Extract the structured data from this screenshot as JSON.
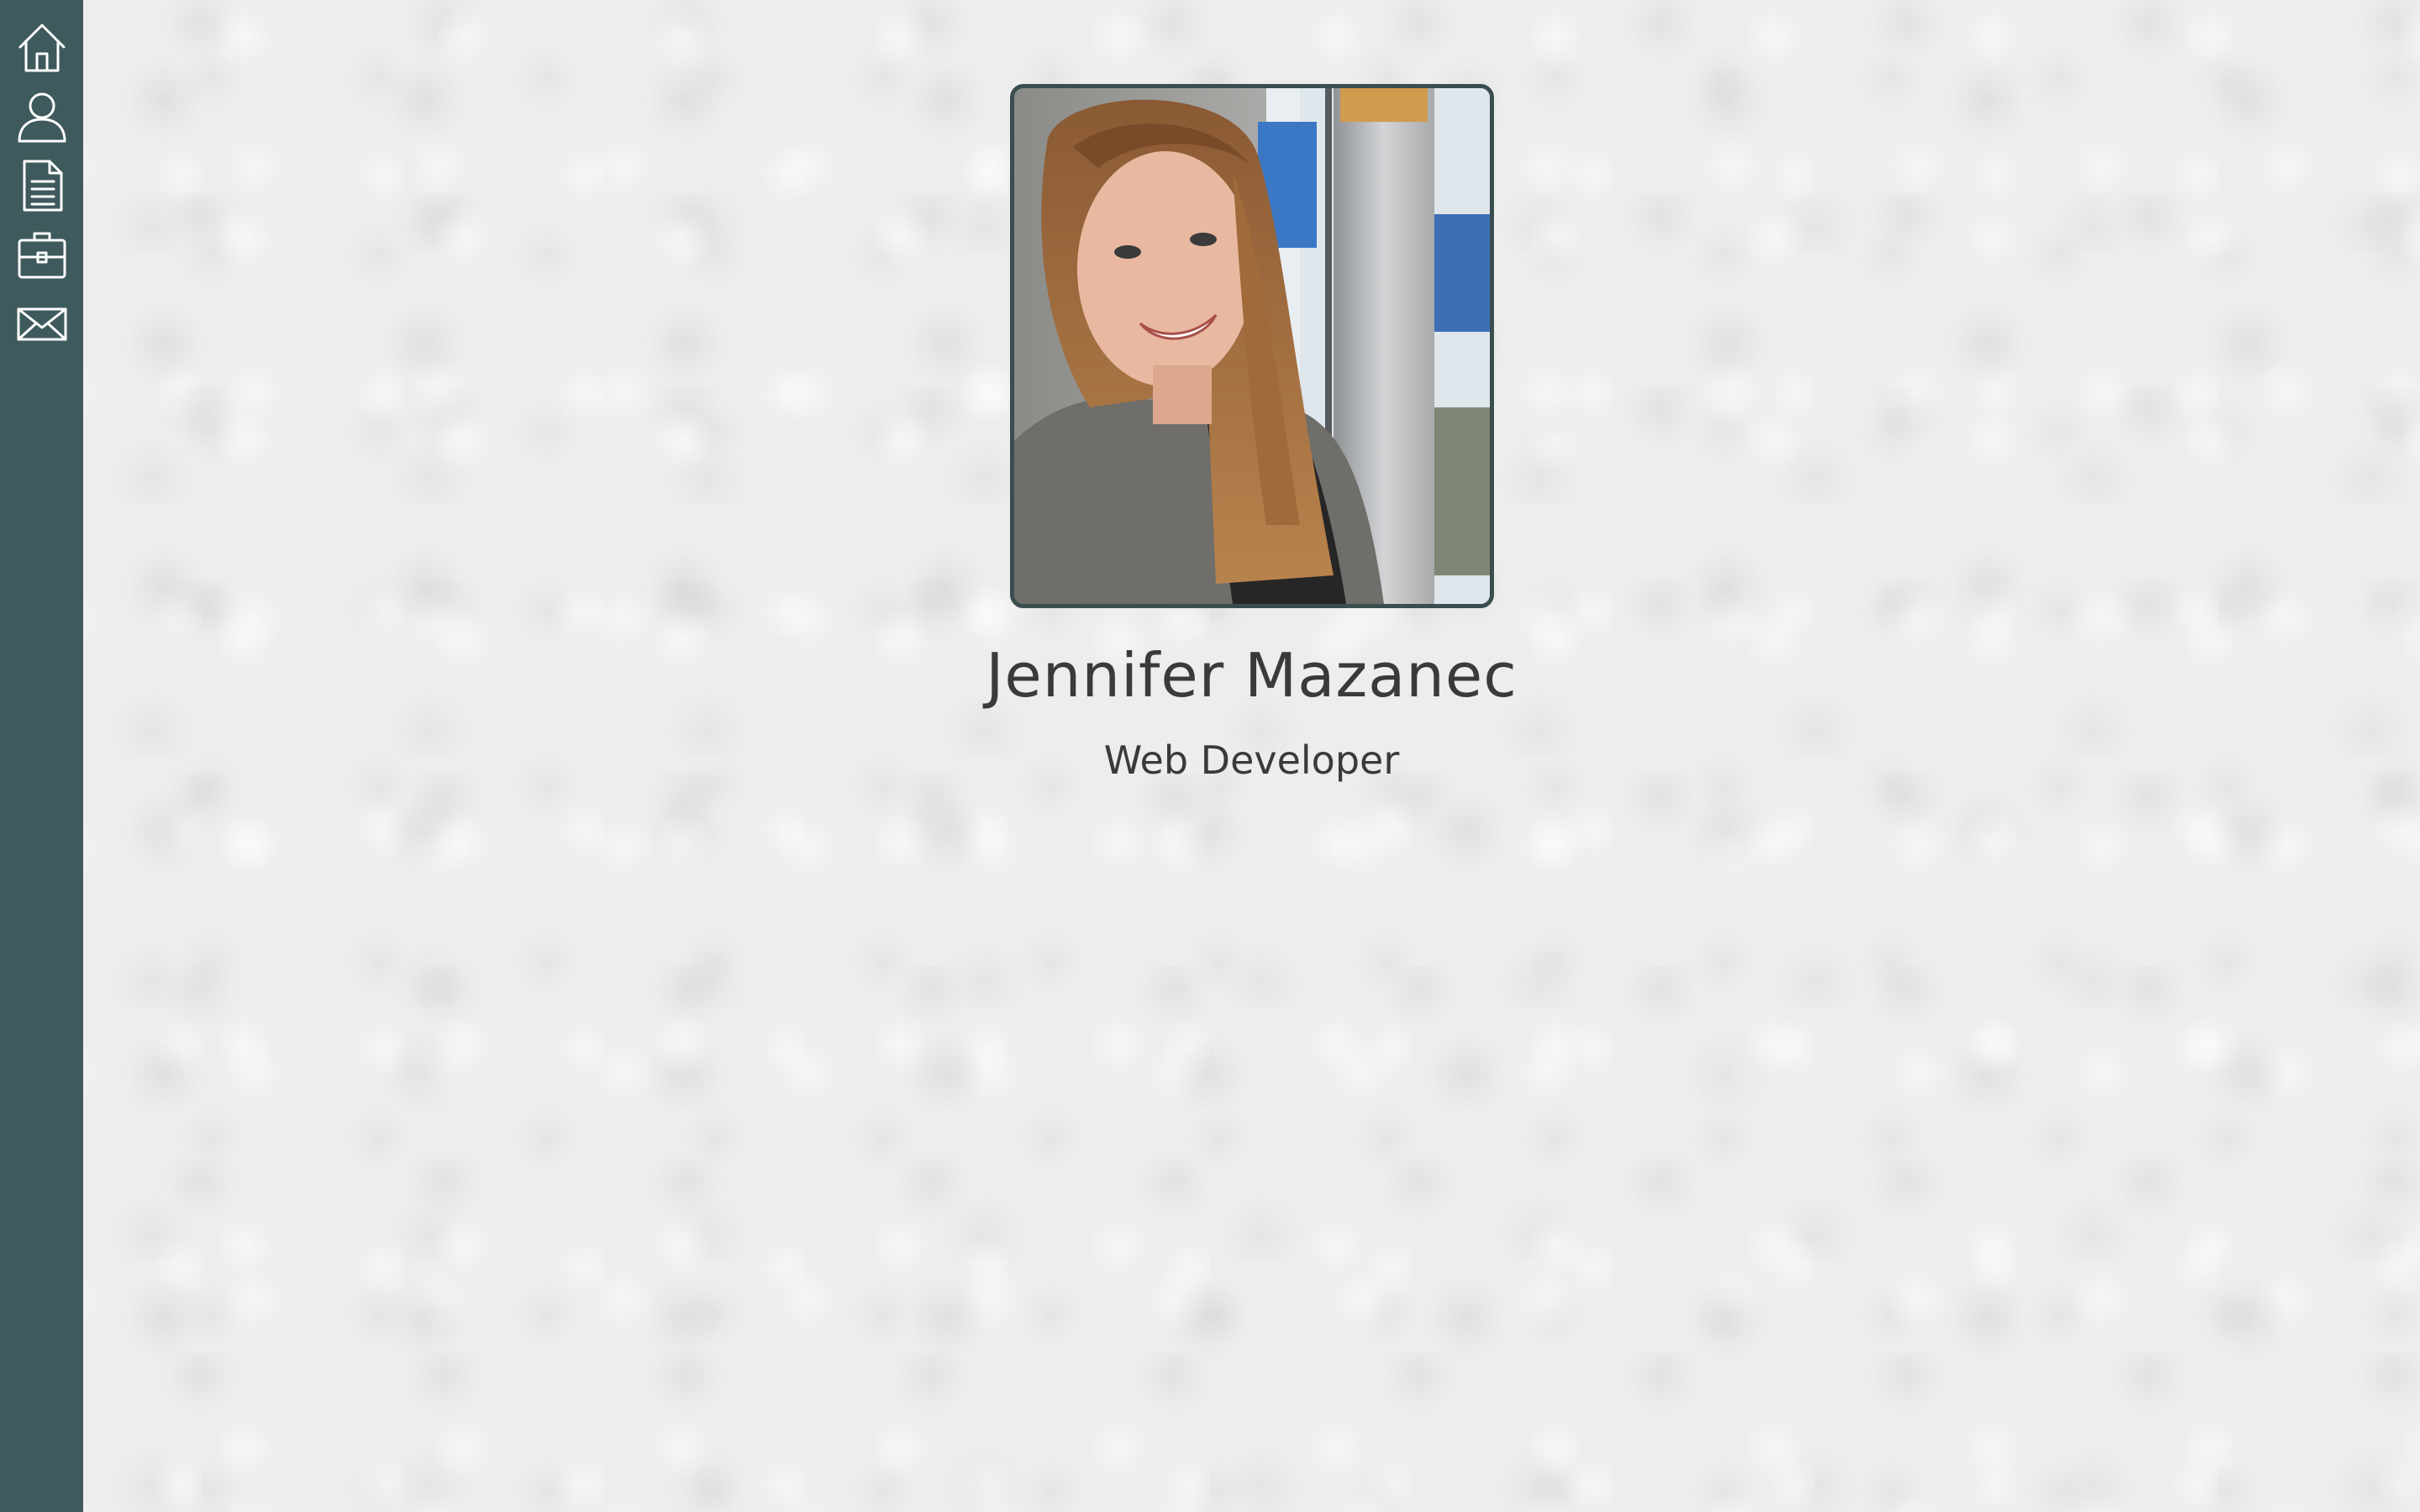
{
  "sidebar": {
    "items": [
      {
        "icon": "home-icon"
      },
      {
        "icon": "user-icon"
      },
      {
        "icon": "document-icon"
      },
      {
        "icon": "briefcase-icon"
      },
      {
        "icon": "mail-icon"
      }
    ],
    "background_color": "#3f5a5c"
  },
  "profile": {
    "name": "Jennifer Mazanec",
    "title": "Web Developer",
    "photo_border_color": "#3a4d4f"
  }
}
